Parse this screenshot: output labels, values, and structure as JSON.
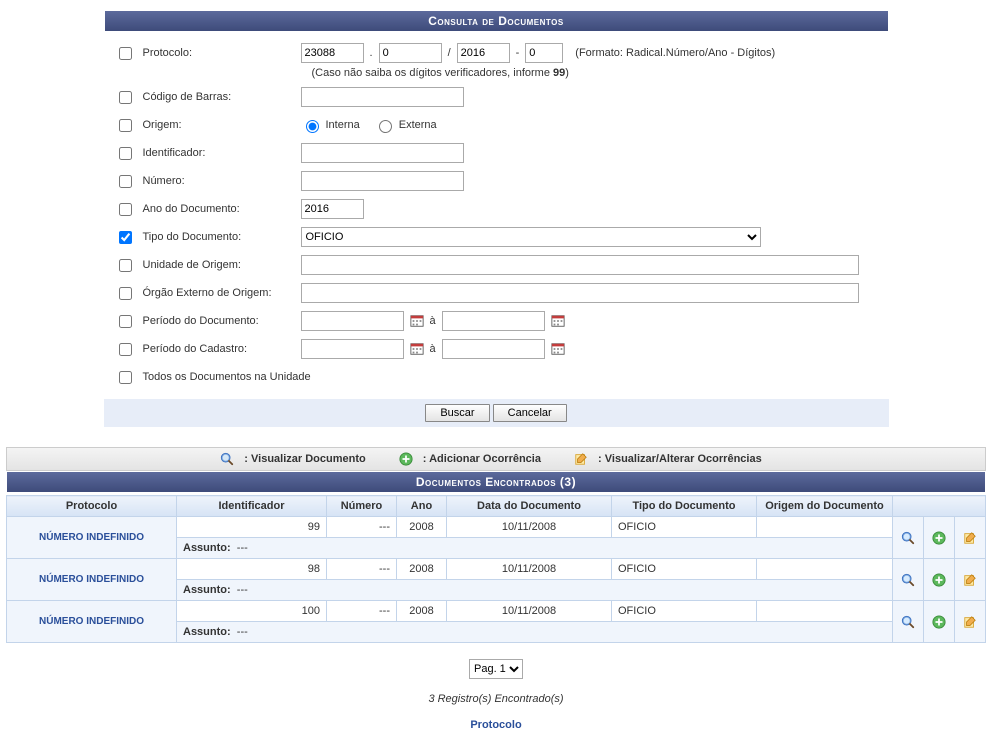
{
  "form": {
    "title": "Consulta de Documentos",
    "protocolo": {
      "label": "Protocolo:",
      "radical": "23088",
      "numero": "0",
      "ano": "2016",
      "digitos": "0",
      "format": "(Formato: Radical.Número/Ano - Dígitos)",
      "hint_pre": "(Caso não saiba os dígitos verificadores, informe ",
      "hint_bold": "99",
      "hint_post": ")"
    },
    "codigo": {
      "label": "Código de Barras:"
    },
    "origem": {
      "label": "Origem:",
      "interna": "Interna",
      "externa": "Externa"
    },
    "identificador": {
      "label": "Identificador:"
    },
    "numero": {
      "label": "Número:"
    },
    "ano": {
      "label": "Ano do Documento:",
      "value": "2016"
    },
    "tipo": {
      "label": "Tipo do Documento:",
      "value": "OFICIO"
    },
    "unidade": {
      "label": "Unidade de Origem:"
    },
    "orgao": {
      "label": "Órgão Externo de Origem:"
    },
    "perDoc": {
      "label": "Período do Documento:",
      "sep": "à"
    },
    "perCad": {
      "label": "Período do Cadastro:",
      "sep": "à"
    },
    "todos": {
      "label": "Todos os Documentos na Unidade"
    },
    "buttons": {
      "buscar": "Buscar",
      "cancelar": "Cancelar"
    }
  },
  "legend": {
    "view": ": Visualizar Documento",
    "add": ": Adicionar Ocorrência",
    "edit": ": Visualizar/Alterar Ocorrências"
  },
  "results": {
    "title": "Documentos Encontrados (3)",
    "headers": {
      "protocolo": "Protocolo",
      "identificador": "Identificador",
      "numero": "Número",
      "ano": "Ano",
      "data": "Data do Documento",
      "tipo": "Tipo do Documento",
      "origem": "Origem do Documento"
    },
    "rows": [
      {
        "protocolo": "NÚMERO INDEFINIDO",
        "identificador": "99",
        "numero": "---",
        "ano": "2008",
        "data": "10/11/2008",
        "tipo": "OFICIO",
        "origem": "",
        "assunto": "---"
      },
      {
        "protocolo": "NÚMERO INDEFINIDO",
        "identificador": "98",
        "numero": "---",
        "ano": "2008",
        "data": "10/11/2008",
        "tipo": "OFICIO",
        "origem": "",
        "assunto": "---"
      },
      {
        "protocolo": "NÚMERO INDEFINIDO",
        "identificador": "100",
        "numero": "---",
        "ano": "2008",
        "data": "10/11/2008",
        "tipo": "OFICIO",
        "origem": "",
        "assunto": "---"
      }
    ],
    "assunto_label": "Assunto:"
  },
  "pagination": {
    "page_label": "Pag. 1",
    "records": "3 Registro(s) Encontrado(s)"
  },
  "footer": {
    "link": "Protocolo"
  }
}
